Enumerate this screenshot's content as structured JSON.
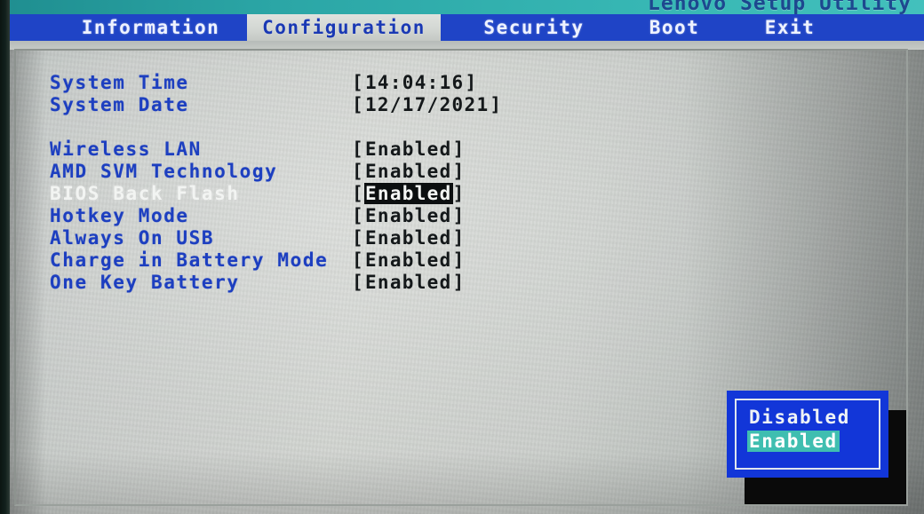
{
  "window": {
    "title": "Lenovo Setup Utility"
  },
  "tabs": [
    {
      "label": "Information",
      "active": false
    },
    {
      "label": "Configuration",
      "active": true
    },
    {
      "label": "Security",
      "active": false
    },
    {
      "label": "Boot",
      "active": false
    },
    {
      "label": "Exit",
      "active": false
    }
  ],
  "settings": [
    {
      "label": "System Time",
      "value": "14:04:16",
      "selected": false
    },
    {
      "label": "System Date",
      "value": "12/17/2021",
      "selected": false
    },
    {
      "label": "Wireless LAN",
      "value": "Enabled",
      "selected": false
    },
    {
      "label": "AMD SVM Technology",
      "value": "Enabled",
      "selected": false
    },
    {
      "label": "BIOS Back Flash",
      "value": "Enabled",
      "selected": true
    },
    {
      "label": "Hotkey Mode",
      "value": "Enabled",
      "selected": false
    },
    {
      "label": "Always On USB",
      "value": "Enabled",
      "selected": false
    },
    {
      "label": "Charge in Battery Mode",
      "value": "Enabled",
      "selected": false
    },
    {
      "label": "One Key Battery",
      "value": "Enabled",
      "selected": false
    }
  ],
  "popup": {
    "options": [
      {
        "label": "Disabled",
        "highlighted": false
      },
      {
        "label": "Enabled",
        "highlighted": true
      }
    ]
  },
  "colors": {
    "titlebar_teal": "#2ba6a6",
    "tabbar_blue": "#1f44c6",
    "label_blue": "#1d3fc0",
    "popup_blue": "#1236d8",
    "highlight_teal": "#3fbeb0",
    "selection_black": "#0c0f10",
    "panel_gray": "#c6cac7"
  }
}
